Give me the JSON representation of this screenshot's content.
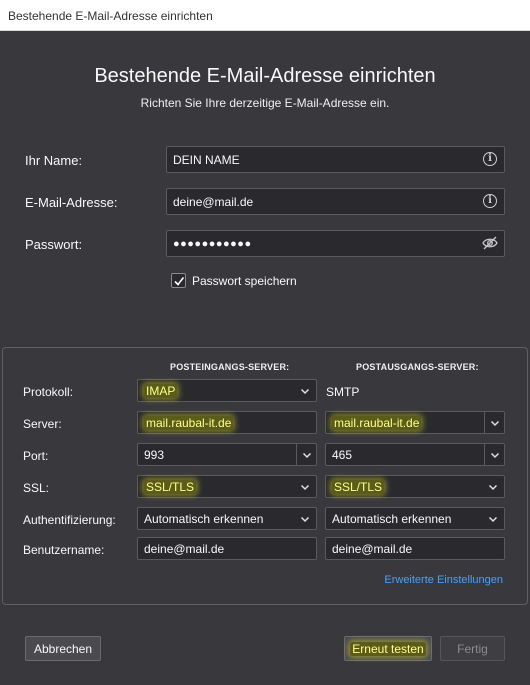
{
  "window": {
    "title": "Bestehende E-Mail-Adresse einrichten"
  },
  "header": {
    "title": "Bestehende E-Mail-Adresse einrichten",
    "subtitle": "Richten Sie Ihre derzeitige E-Mail-Adresse ein."
  },
  "form": {
    "name_label": "Ihr Name:",
    "name_value": "DEIN NAME",
    "email_label": "E-Mail-Adresse:",
    "email_value": "deine@mail.de",
    "password_label": "Passwort:",
    "password_value": "●●●●●●●●●●●",
    "save_password_label": "Passwort speichern",
    "save_password_checked": true
  },
  "server": {
    "incoming_header": "POSTEINGANGS-SERVER:",
    "outgoing_header": "POSTAUSGANGS-SERVER:",
    "protocol_label": "Protokoll:",
    "incoming_protocol": "IMAP",
    "outgoing_protocol": "SMTP",
    "server_label": "Server:",
    "incoming_server": "mail.raubal-it.de",
    "outgoing_server": "mail.raubal-it.de",
    "port_label": "Port:",
    "incoming_port": "993",
    "outgoing_port": "465",
    "ssl_label": "SSL:",
    "incoming_ssl": "SSL/TLS",
    "outgoing_ssl": "SSL/TLS",
    "auth_label": "Authentifizierung:",
    "incoming_auth": "Automatisch erkennen",
    "outgoing_auth": "Automatisch erkennen",
    "username_label": "Benutzername:",
    "incoming_username": "deine@mail.de",
    "outgoing_username": "deine@mail.de",
    "advanced_link": "Erweiterte Einstellungen"
  },
  "footer": {
    "cancel_label": "Abbrechen",
    "retest_label": "Erneut testen",
    "done_label": "Fertig"
  },
  "colors": {
    "background": "#38383d",
    "input_bg": "#2a2a2e",
    "link": "#45a1ff",
    "highlight": "#ffff8a"
  }
}
